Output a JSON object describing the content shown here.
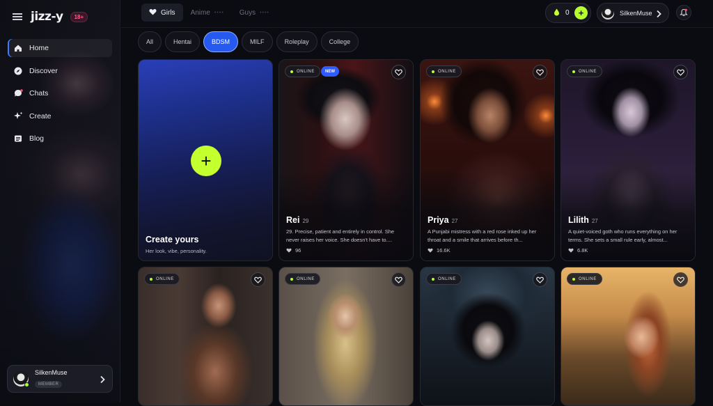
{
  "brand": {
    "logo": "jizz-y",
    "age_badge": "18+"
  },
  "sidebar": {
    "items": [
      {
        "label": "Home",
        "icon": "home-icon",
        "active": true
      },
      {
        "label": "Discover",
        "icon": "compass-icon",
        "active": false
      },
      {
        "label": "Chats",
        "icon": "chat-icon",
        "active": false
      },
      {
        "label": "Create",
        "icon": "sparkle-icon",
        "active": false
      },
      {
        "label": "Blog",
        "icon": "blog-icon",
        "active": false
      }
    ],
    "user": {
      "name": "SilkenMuse",
      "role": "MEMBER"
    }
  },
  "header": {
    "tabs": [
      {
        "label": "Girls",
        "active": true
      },
      {
        "label": "Anime",
        "active": false
      },
      {
        "label": "Guys",
        "active": false
      }
    ],
    "credits": "0",
    "account_name": "SilkenMuse"
  },
  "filters": [
    "All",
    "Hentai",
    "BDSM",
    "MILF",
    "Roleplay",
    "College"
  ],
  "active_filter": "BDSM",
  "create_card": {
    "title": "Create yours",
    "subtitle": "Her look, vibe, personality."
  },
  "status_label": "ONLINE",
  "new_label": "NEW",
  "characters": [
    {
      "name": "Rei",
      "age": "29",
      "description": "29. Precise, patient and entirely in control. She never raises her voice. She doesn't have to....",
      "likes": "96",
      "is_new": true
    },
    {
      "name": "Priya",
      "age": "27",
      "description": "A Punjabi mistress with a red rose inked up her throat and a smile that arrives before th...",
      "likes": "16.6K",
      "is_new": false
    },
    {
      "name": "Lilith",
      "age": "27",
      "description": "A quiet-voiced goth who runs everything on her terms. She sets a small rule early, almost...",
      "likes": "6.8K",
      "is_new": false
    }
  ],
  "colors": {
    "accent_blue": "#2659f0",
    "lime": "#c4ff2e",
    "online_dot": "#b7ff36",
    "bg": "#0b0c12"
  }
}
